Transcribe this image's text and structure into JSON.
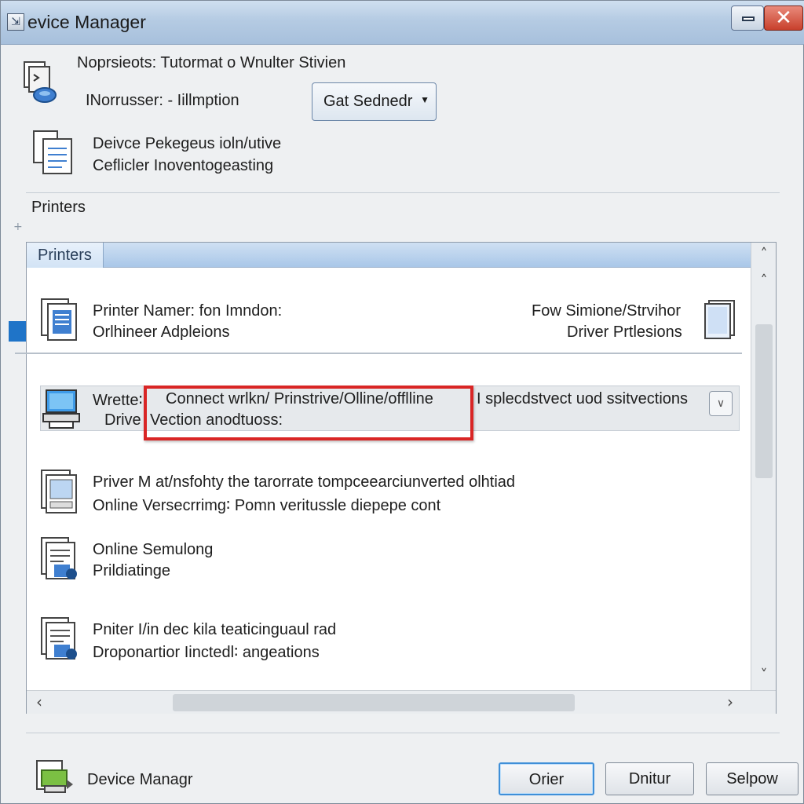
{
  "window": {
    "title": "evice Manager",
    "title_icon": "app-icon",
    "minimize": "minimize-icon",
    "close_glyph": "✕"
  },
  "header": {
    "line1": "Noprsieots: Tutormat o Wnulter Stivien",
    "line2": "INorrusser:  -  Iillmption",
    "dropdown_value": "Gat Sednedr",
    "desc_line1": "Deivce Pekegeus ioln/utive",
    "desc_line2": "Ceflicler Inoventogeasting"
  },
  "section_label": "Printers",
  "panel": {
    "tab_label": "Printers",
    "rows": [
      {
        "line1": "Printer Namer: fon Imndon:",
        "line2": "Orlhineer Adpleions",
        "right1": "Fow Simione/Strvihor",
        "right2": "Driver Prtlesions"
      },
      {
        "prefix": "Wrette∶",
        "middle": "Connect wrlkn/ Prinstrive/Olline/offlline",
        "right": "I splecdstvect uod ssitvections",
        "line2_prefix": "Drive",
        "line2": "Vection anodtuoss:"
      },
      {
        "line1": "Priver M at/nsfohty the tarorrate tompceearciunverted olhtiad",
        "line2": "Online Versecrrimg∶ Pomn veritussle diepepe cont"
      },
      {
        "line1": "Online Semulong",
        "line2": "Prildiatinge"
      },
      {
        "line1": "Pniter I/in dec kila teaticinguaul rad",
        "line2": "Droponartior Iinctedl∶ angeations"
      }
    ]
  },
  "footer": {
    "app_label": "Device Managr",
    "buttons": [
      "Orier",
      "Dnitur",
      "Selpow"
    ]
  }
}
